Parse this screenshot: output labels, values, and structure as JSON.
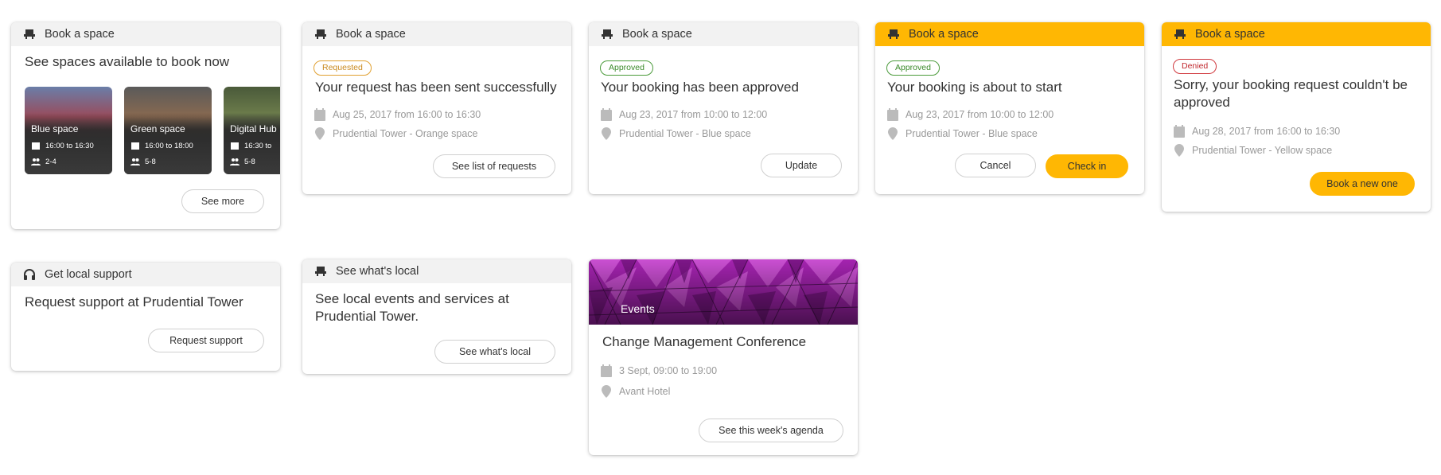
{
  "colors": {
    "accent": "#ffb703",
    "requested": "#e0a030",
    "approved": "#4a9a3a",
    "denied": "#d0383d"
  },
  "card1": {
    "header": "Book a space",
    "title": "See spaces available to book now",
    "tiles": [
      {
        "name": "Blue space",
        "time": "16:00 to 16:30",
        "capacity": "2-4"
      },
      {
        "name": "Green space",
        "time": "16:00 to 18:00",
        "capacity": "5-8"
      },
      {
        "name": "Digital Hub",
        "time": "16:30 to",
        "capacity": "5-8"
      }
    ],
    "button": "See more"
  },
  "card2": {
    "header": "Book a space",
    "badge": "Requested",
    "title": "Your request has been sent successfully",
    "date": "Aug 25, 2017 from 16:00 to 16:30",
    "location": "Prudential Tower - Orange space",
    "button": "See list of requests"
  },
  "card3": {
    "header": "Book a space",
    "badge": "Approved",
    "title": "Your booking has been approved",
    "date": "Aug 23, 2017 from 10:00 to 12:00",
    "location": "Prudential Tower - Blue space",
    "button": "Update"
  },
  "card4": {
    "header": "Book a space",
    "badge": "Approved",
    "title": "Your booking is about to start",
    "date": "Aug 23, 2017 from 10:00 to 12:00",
    "location": "Prudential Tower - Blue space",
    "cancel": "Cancel",
    "checkin": "Check in"
  },
  "card5": {
    "header": "Book a space",
    "badge": "Denied",
    "title": "Sorry, your booking request couldn't be approved",
    "date": "Aug 28, 2017 from 16:00 to 16:30",
    "location": "Prudential Tower - Yellow space",
    "button": "Book a new one"
  },
  "card6": {
    "header": "Get local support",
    "title": "Request support at Prudential Tower",
    "button": "Request support"
  },
  "card7": {
    "header": "See what's local",
    "title": "See local events and services at Prudential Tower.",
    "button": "See what's local"
  },
  "card8": {
    "image_label": "Events",
    "title": "Change Management Conference",
    "date": "3 Sept, 09:00 to 19:00",
    "location": "Avant Hotel",
    "button": "See this week's agenda"
  }
}
